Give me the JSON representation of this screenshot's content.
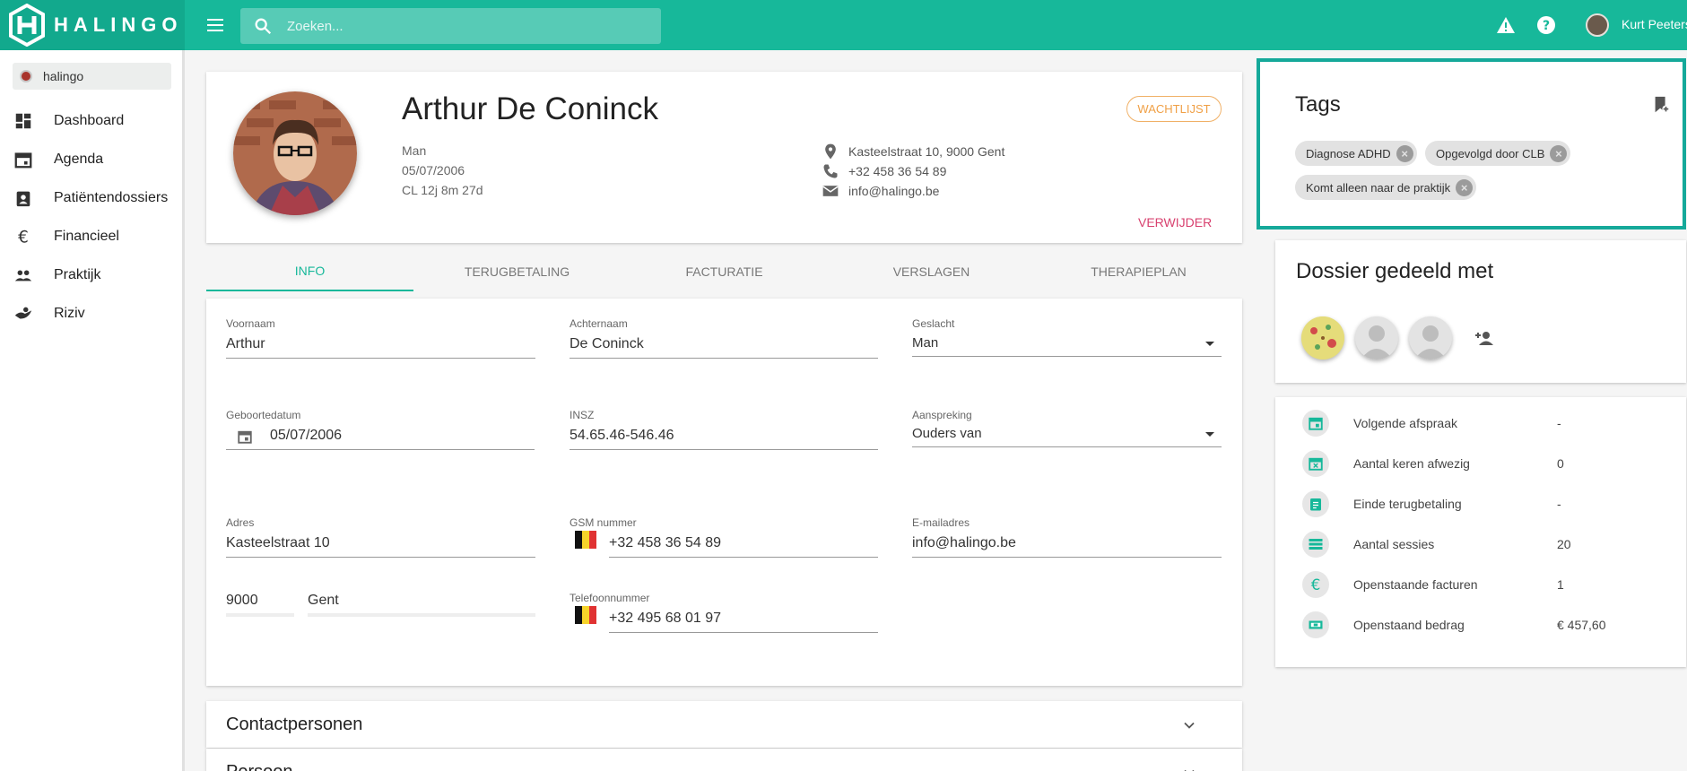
{
  "app": {
    "brand": "HALINGO",
    "search_placeholder": "Zoeken...",
    "user_name": "Kurt Peeters"
  },
  "sidebar": {
    "org": "halingo",
    "items": [
      {
        "label": "Dashboard"
      },
      {
        "label": "Agenda"
      },
      {
        "label": "Patiëntendossiers"
      },
      {
        "label": "Financieel"
      },
      {
        "label": "Praktijk"
      },
      {
        "label": "Riziv"
      }
    ]
  },
  "patient": {
    "name": "Arthur De Coninck",
    "gender": "Man",
    "birthdate": "05/07/2006",
    "age_line": "CL 12j 8m 27d",
    "address": "Kasteelstraat 10, 9000 Gent",
    "phone": "+32 458 36 54 89",
    "email": "info@halingo.be",
    "status_badge": "WACHTLIJST",
    "delete_label": "VERWIJDER"
  },
  "tabs": [
    "INFO",
    "TERUGBETALING",
    "FACTURATIE",
    "VERSLAGEN",
    "THERAPIEPLAN"
  ],
  "form": {
    "voornaam": {
      "label": "Voornaam",
      "value": "Arthur"
    },
    "achternaam": {
      "label": "Achternaam",
      "value": "De Coninck"
    },
    "geslacht": {
      "label": "Geslacht",
      "value": "Man"
    },
    "geboortedatum": {
      "label": "Geboortedatum",
      "value": "05/07/2006"
    },
    "insz": {
      "label": "INSZ",
      "value": "54.65.46-546.46"
    },
    "aanspreking": {
      "label": "Aanspreking",
      "value": "Ouders van"
    },
    "adres": {
      "label": "Adres",
      "value": "Kasteelstraat 10"
    },
    "gsm": {
      "label": "GSM nummer",
      "value": "+32 458 36 54 89"
    },
    "email": {
      "label": "E-mailadres",
      "value": "info@halingo.be"
    },
    "postcode": {
      "value": "9000"
    },
    "gemeente": {
      "value": "Gent"
    },
    "telefoon": {
      "label": "Telefoonnummer",
      "value": "+32 495 68 01 97"
    }
  },
  "sections": {
    "contactpersonen": "Contactpersonen",
    "next": "Persoon"
  },
  "tags": {
    "title": "Tags",
    "items": [
      "Diagnose ADHD",
      "Opgevolgd door CLB",
      "Komt alleen naar de praktijk"
    ]
  },
  "shared": {
    "title": "Dossier gedeeld met"
  },
  "stats": [
    {
      "icon": "calendar-icon",
      "label": "Volgende afspraak",
      "value": "-"
    },
    {
      "icon": "calendar-x-icon",
      "label": "Aantal keren afwezig",
      "value": "0"
    },
    {
      "icon": "clipboard-icon",
      "label": "Einde terugbetaling",
      "value": "-"
    },
    {
      "icon": "list-icon",
      "label": "Aantal sessies",
      "value": "20"
    },
    {
      "icon": "euro-icon",
      "label": "Openstaande facturen",
      "value": "1"
    },
    {
      "icon": "money-icon",
      "label": "Openstaand bedrag",
      "value": "€ 457,60"
    }
  ],
  "colors": {
    "primary": "#17b89a",
    "badge": "#f0a046",
    "danger": "#d8416f",
    "highlight": "#15a99a"
  }
}
